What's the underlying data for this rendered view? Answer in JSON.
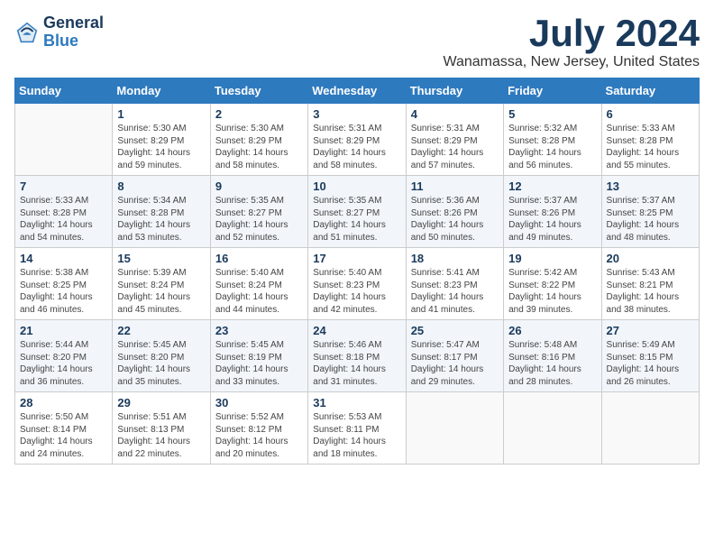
{
  "header": {
    "logo_general": "General",
    "logo_blue": "Blue",
    "title": "July 2024",
    "location": "Wanamassa, New Jersey, United States"
  },
  "columns": [
    "Sunday",
    "Monday",
    "Tuesday",
    "Wednesday",
    "Thursday",
    "Friday",
    "Saturday"
  ],
  "weeks": [
    [
      {
        "num": "",
        "info": ""
      },
      {
        "num": "1",
        "info": "Sunrise: 5:30 AM\nSunset: 8:29 PM\nDaylight: 14 hours\nand 59 minutes."
      },
      {
        "num": "2",
        "info": "Sunrise: 5:30 AM\nSunset: 8:29 PM\nDaylight: 14 hours\nand 58 minutes."
      },
      {
        "num": "3",
        "info": "Sunrise: 5:31 AM\nSunset: 8:29 PM\nDaylight: 14 hours\nand 58 minutes."
      },
      {
        "num": "4",
        "info": "Sunrise: 5:31 AM\nSunset: 8:29 PM\nDaylight: 14 hours\nand 57 minutes."
      },
      {
        "num": "5",
        "info": "Sunrise: 5:32 AM\nSunset: 8:28 PM\nDaylight: 14 hours\nand 56 minutes."
      },
      {
        "num": "6",
        "info": "Sunrise: 5:33 AM\nSunset: 8:28 PM\nDaylight: 14 hours\nand 55 minutes."
      }
    ],
    [
      {
        "num": "7",
        "info": "Sunrise: 5:33 AM\nSunset: 8:28 PM\nDaylight: 14 hours\nand 54 minutes."
      },
      {
        "num": "8",
        "info": "Sunrise: 5:34 AM\nSunset: 8:28 PM\nDaylight: 14 hours\nand 53 minutes."
      },
      {
        "num": "9",
        "info": "Sunrise: 5:35 AM\nSunset: 8:27 PM\nDaylight: 14 hours\nand 52 minutes."
      },
      {
        "num": "10",
        "info": "Sunrise: 5:35 AM\nSunset: 8:27 PM\nDaylight: 14 hours\nand 51 minutes."
      },
      {
        "num": "11",
        "info": "Sunrise: 5:36 AM\nSunset: 8:26 PM\nDaylight: 14 hours\nand 50 minutes."
      },
      {
        "num": "12",
        "info": "Sunrise: 5:37 AM\nSunset: 8:26 PM\nDaylight: 14 hours\nand 49 minutes."
      },
      {
        "num": "13",
        "info": "Sunrise: 5:37 AM\nSunset: 8:25 PM\nDaylight: 14 hours\nand 48 minutes."
      }
    ],
    [
      {
        "num": "14",
        "info": "Sunrise: 5:38 AM\nSunset: 8:25 PM\nDaylight: 14 hours\nand 46 minutes."
      },
      {
        "num": "15",
        "info": "Sunrise: 5:39 AM\nSunset: 8:24 PM\nDaylight: 14 hours\nand 45 minutes."
      },
      {
        "num": "16",
        "info": "Sunrise: 5:40 AM\nSunset: 8:24 PM\nDaylight: 14 hours\nand 44 minutes."
      },
      {
        "num": "17",
        "info": "Sunrise: 5:40 AM\nSunset: 8:23 PM\nDaylight: 14 hours\nand 42 minutes."
      },
      {
        "num": "18",
        "info": "Sunrise: 5:41 AM\nSunset: 8:23 PM\nDaylight: 14 hours\nand 41 minutes."
      },
      {
        "num": "19",
        "info": "Sunrise: 5:42 AM\nSunset: 8:22 PM\nDaylight: 14 hours\nand 39 minutes."
      },
      {
        "num": "20",
        "info": "Sunrise: 5:43 AM\nSunset: 8:21 PM\nDaylight: 14 hours\nand 38 minutes."
      }
    ],
    [
      {
        "num": "21",
        "info": "Sunrise: 5:44 AM\nSunset: 8:20 PM\nDaylight: 14 hours\nand 36 minutes."
      },
      {
        "num": "22",
        "info": "Sunrise: 5:45 AM\nSunset: 8:20 PM\nDaylight: 14 hours\nand 35 minutes."
      },
      {
        "num": "23",
        "info": "Sunrise: 5:45 AM\nSunset: 8:19 PM\nDaylight: 14 hours\nand 33 minutes."
      },
      {
        "num": "24",
        "info": "Sunrise: 5:46 AM\nSunset: 8:18 PM\nDaylight: 14 hours\nand 31 minutes."
      },
      {
        "num": "25",
        "info": "Sunrise: 5:47 AM\nSunset: 8:17 PM\nDaylight: 14 hours\nand 29 minutes."
      },
      {
        "num": "26",
        "info": "Sunrise: 5:48 AM\nSunset: 8:16 PM\nDaylight: 14 hours\nand 28 minutes."
      },
      {
        "num": "27",
        "info": "Sunrise: 5:49 AM\nSunset: 8:15 PM\nDaylight: 14 hours\nand 26 minutes."
      }
    ],
    [
      {
        "num": "28",
        "info": "Sunrise: 5:50 AM\nSunset: 8:14 PM\nDaylight: 14 hours\nand 24 minutes."
      },
      {
        "num": "29",
        "info": "Sunrise: 5:51 AM\nSunset: 8:13 PM\nDaylight: 14 hours\nand 22 minutes."
      },
      {
        "num": "30",
        "info": "Sunrise: 5:52 AM\nSunset: 8:12 PM\nDaylight: 14 hours\nand 20 minutes."
      },
      {
        "num": "31",
        "info": "Sunrise: 5:53 AM\nSunset: 8:11 PM\nDaylight: 14 hours\nand 18 minutes."
      },
      {
        "num": "",
        "info": ""
      },
      {
        "num": "",
        "info": ""
      },
      {
        "num": "",
        "info": ""
      }
    ]
  ]
}
